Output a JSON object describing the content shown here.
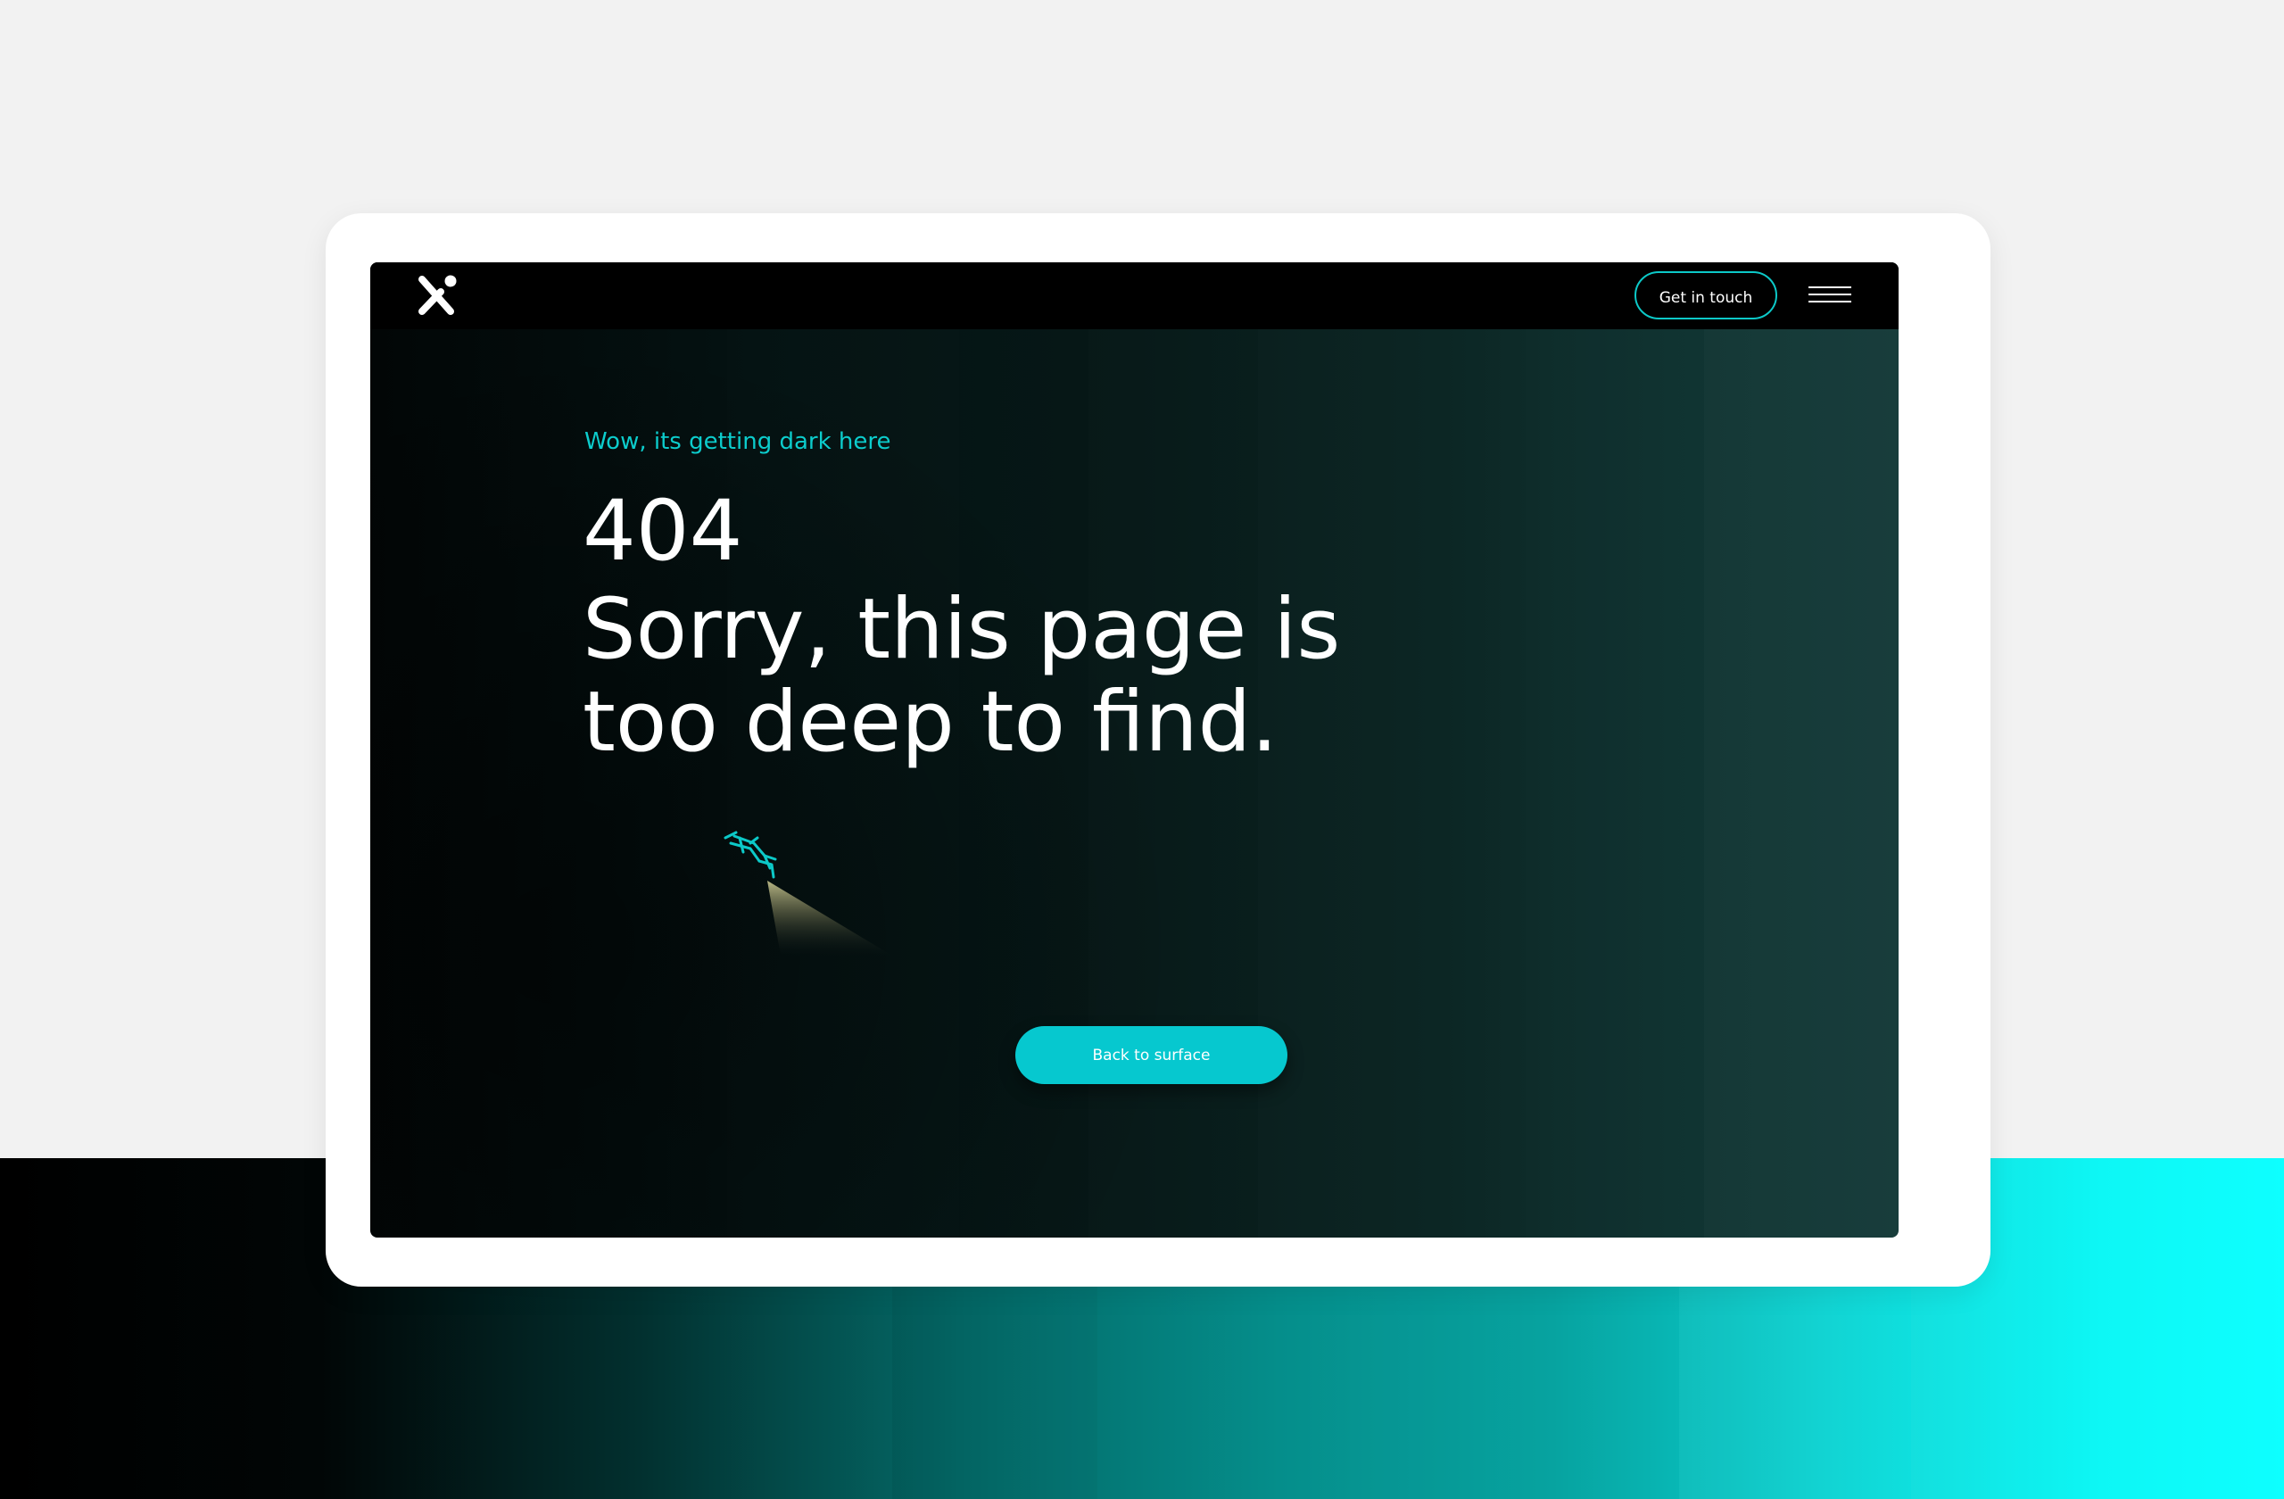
{
  "nav": {
    "logo_icon": "x-logo-icon",
    "cta_label": "Get in touch",
    "menu_icon": "hamburger-menu-icon"
  },
  "hero": {
    "kicker": "Wow, its getting dark here",
    "code": "404",
    "message": "Sorry, this page is too deep to find.",
    "illustration_icon": "scuba-diver-icon",
    "button_label": "Back to surface"
  },
  "colors": {
    "accent": "#0CCCCC",
    "button": "#06C8CF",
    "nav_background": "#000000",
    "page_background": "#020606",
    "frame": "#FFFFFF",
    "backdrop_light": "#F2F2F2"
  }
}
